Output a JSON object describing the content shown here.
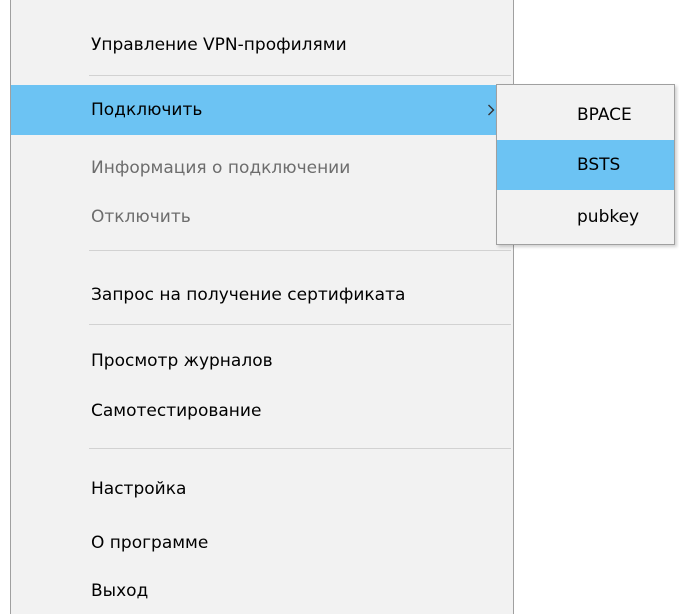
{
  "menu": {
    "items": [
      {
        "label": "Управление VPN-профилями"
      },
      {
        "label": "Подключить"
      },
      {
        "label": "Информация о подключении"
      },
      {
        "label": "Отключить"
      },
      {
        "label": "Запрос на получение сертификата"
      },
      {
        "label": "Просмотр журналов"
      },
      {
        "label": "Самотестирование"
      },
      {
        "label": "Настройка"
      },
      {
        "label": "О программе"
      },
      {
        "label": "Выход"
      }
    ],
    "highlight_color": "#6cc3f3",
    "disabled_color": "#6d6d6d"
  },
  "submenu": {
    "items": [
      {
        "label": "BPACE"
      },
      {
        "label": "BSTS"
      },
      {
        "label": "pubkey"
      }
    ]
  }
}
